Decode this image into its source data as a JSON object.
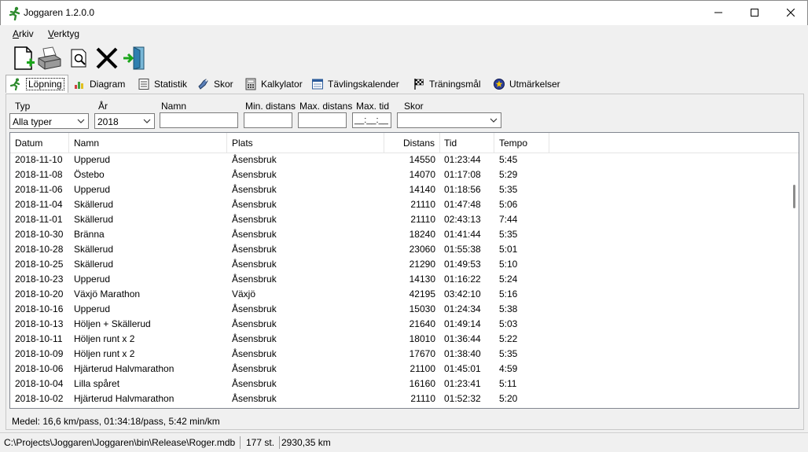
{
  "window": {
    "title": "Joggaren 1.2.0.0"
  },
  "menu": [
    {
      "label": "Arkiv",
      "ul": "A",
      "rest": "rkiv"
    },
    {
      "label": "Verktyg",
      "ul": "V",
      "rest": "erktyg"
    }
  ],
  "toolbar": [
    "new-document-icon",
    "print-icon",
    "print-preview-icon",
    "delete-icon",
    "exit-icon"
  ],
  "tabs": [
    "Löpning",
    "Diagram",
    "Statistik",
    "Skor",
    "Kalkylator",
    "Tävlingskalender",
    "Träningsmål",
    "Utmärkelser"
  ],
  "filters": {
    "typ_label": "Typ",
    "typ_value": "Alla typer",
    "ar_label": "År",
    "ar_value": "2018",
    "namn_label": "Namn",
    "namn_value": "",
    "min_label": "Min. distans",
    "min_value": "",
    "max_label": "Max. distans",
    "max_value": "",
    "tid_label": "Max. tid",
    "tid_value": "__:__:__",
    "skor_label": "Skor",
    "skor_value": ""
  },
  "columns": [
    "Datum",
    "Namn",
    "Plats",
    "Distans",
    "Tid",
    "Tempo"
  ],
  "rows": [
    [
      "2018-11-10",
      "Upperud",
      "Åsensbruk",
      "14550",
      "01:23:44",
      "5:45"
    ],
    [
      "2018-11-08",
      "Östebo",
      "Åsensbruk",
      "14070",
      "01:17:08",
      "5:29"
    ],
    [
      "2018-11-06",
      "Upperud",
      "Åsensbruk",
      "14140",
      "01:18:56",
      "5:35"
    ],
    [
      "2018-11-04",
      "Skällerud",
      "Åsensbruk",
      "21110",
      "01:47:48",
      "5:06"
    ],
    [
      "2018-11-01",
      "Skällerud",
      "Åsensbruk",
      "21110",
      "02:43:13",
      "7:44"
    ],
    [
      "2018-10-30",
      "Bränna",
      "Åsensbruk",
      "18240",
      "01:41:44",
      "5:35"
    ],
    [
      "2018-10-28",
      "Skällerud",
      "Åsensbruk",
      "23060",
      "01:55:38",
      "5:01"
    ],
    [
      "2018-10-25",
      "Skällerud",
      "Åsensbruk",
      "21290",
      "01:49:53",
      "5:10"
    ],
    [
      "2018-10-23",
      "Upperud",
      "Åsensbruk",
      "14130",
      "01:16:22",
      "5:24"
    ],
    [
      "2018-10-20",
      "Växjö Marathon",
      "Växjö",
      "42195",
      "03:42:10",
      "5:16"
    ],
    [
      "2018-10-16",
      "Upperud",
      "Åsensbruk",
      "15030",
      "01:24:34",
      "5:38"
    ],
    [
      "2018-10-13",
      "Höljen + Skällerud",
      "Åsensbruk",
      "21640",
      "01:49:14",
      "5:03"
    ],
    [
      "2018-10-11",
      "Höljen runt x 2",
      "Åsensbruk",
      "18010",
      "01:36:44",
      "5:22"
    ],
    [
      "2018-10-09",
      "Höljen runt x 2",
      "Åsensbruk",
      "17670",
      "01:38:40",
      "5:35"
    ],
    [
      "2018-10-06",
      "Hjärterud Halvmarathon",
      "Åsensbruk",
      "21100",
      "01:45:01",
      "4:59"
    ],
    [
      "2018-10-04",
      "Lilla spåret",
      "Åsensbruk",
      "16160",
      "01:23:41",
      "5:11"
    ],
    [
      "2018-10-02",
      "Hjärterud Halvmarathon",
      "Åsensbruk",
      "21110",
      "01:52:32",
      "5:20"
    ]
  ],
  "summary": "Medel: 16,6 km/pass, 01:34:18/pass, 5:42 min/km",
  "status": {
    "path": "C:\\Projects\\Joggaren\\Joggaren\\bin\\Release\\Roger.mdb",
    "count": "177 st.",
    "distance": "2930,35 km"
  },
  "colors": {
    "accent": "#2e8b2e"
  }
}
